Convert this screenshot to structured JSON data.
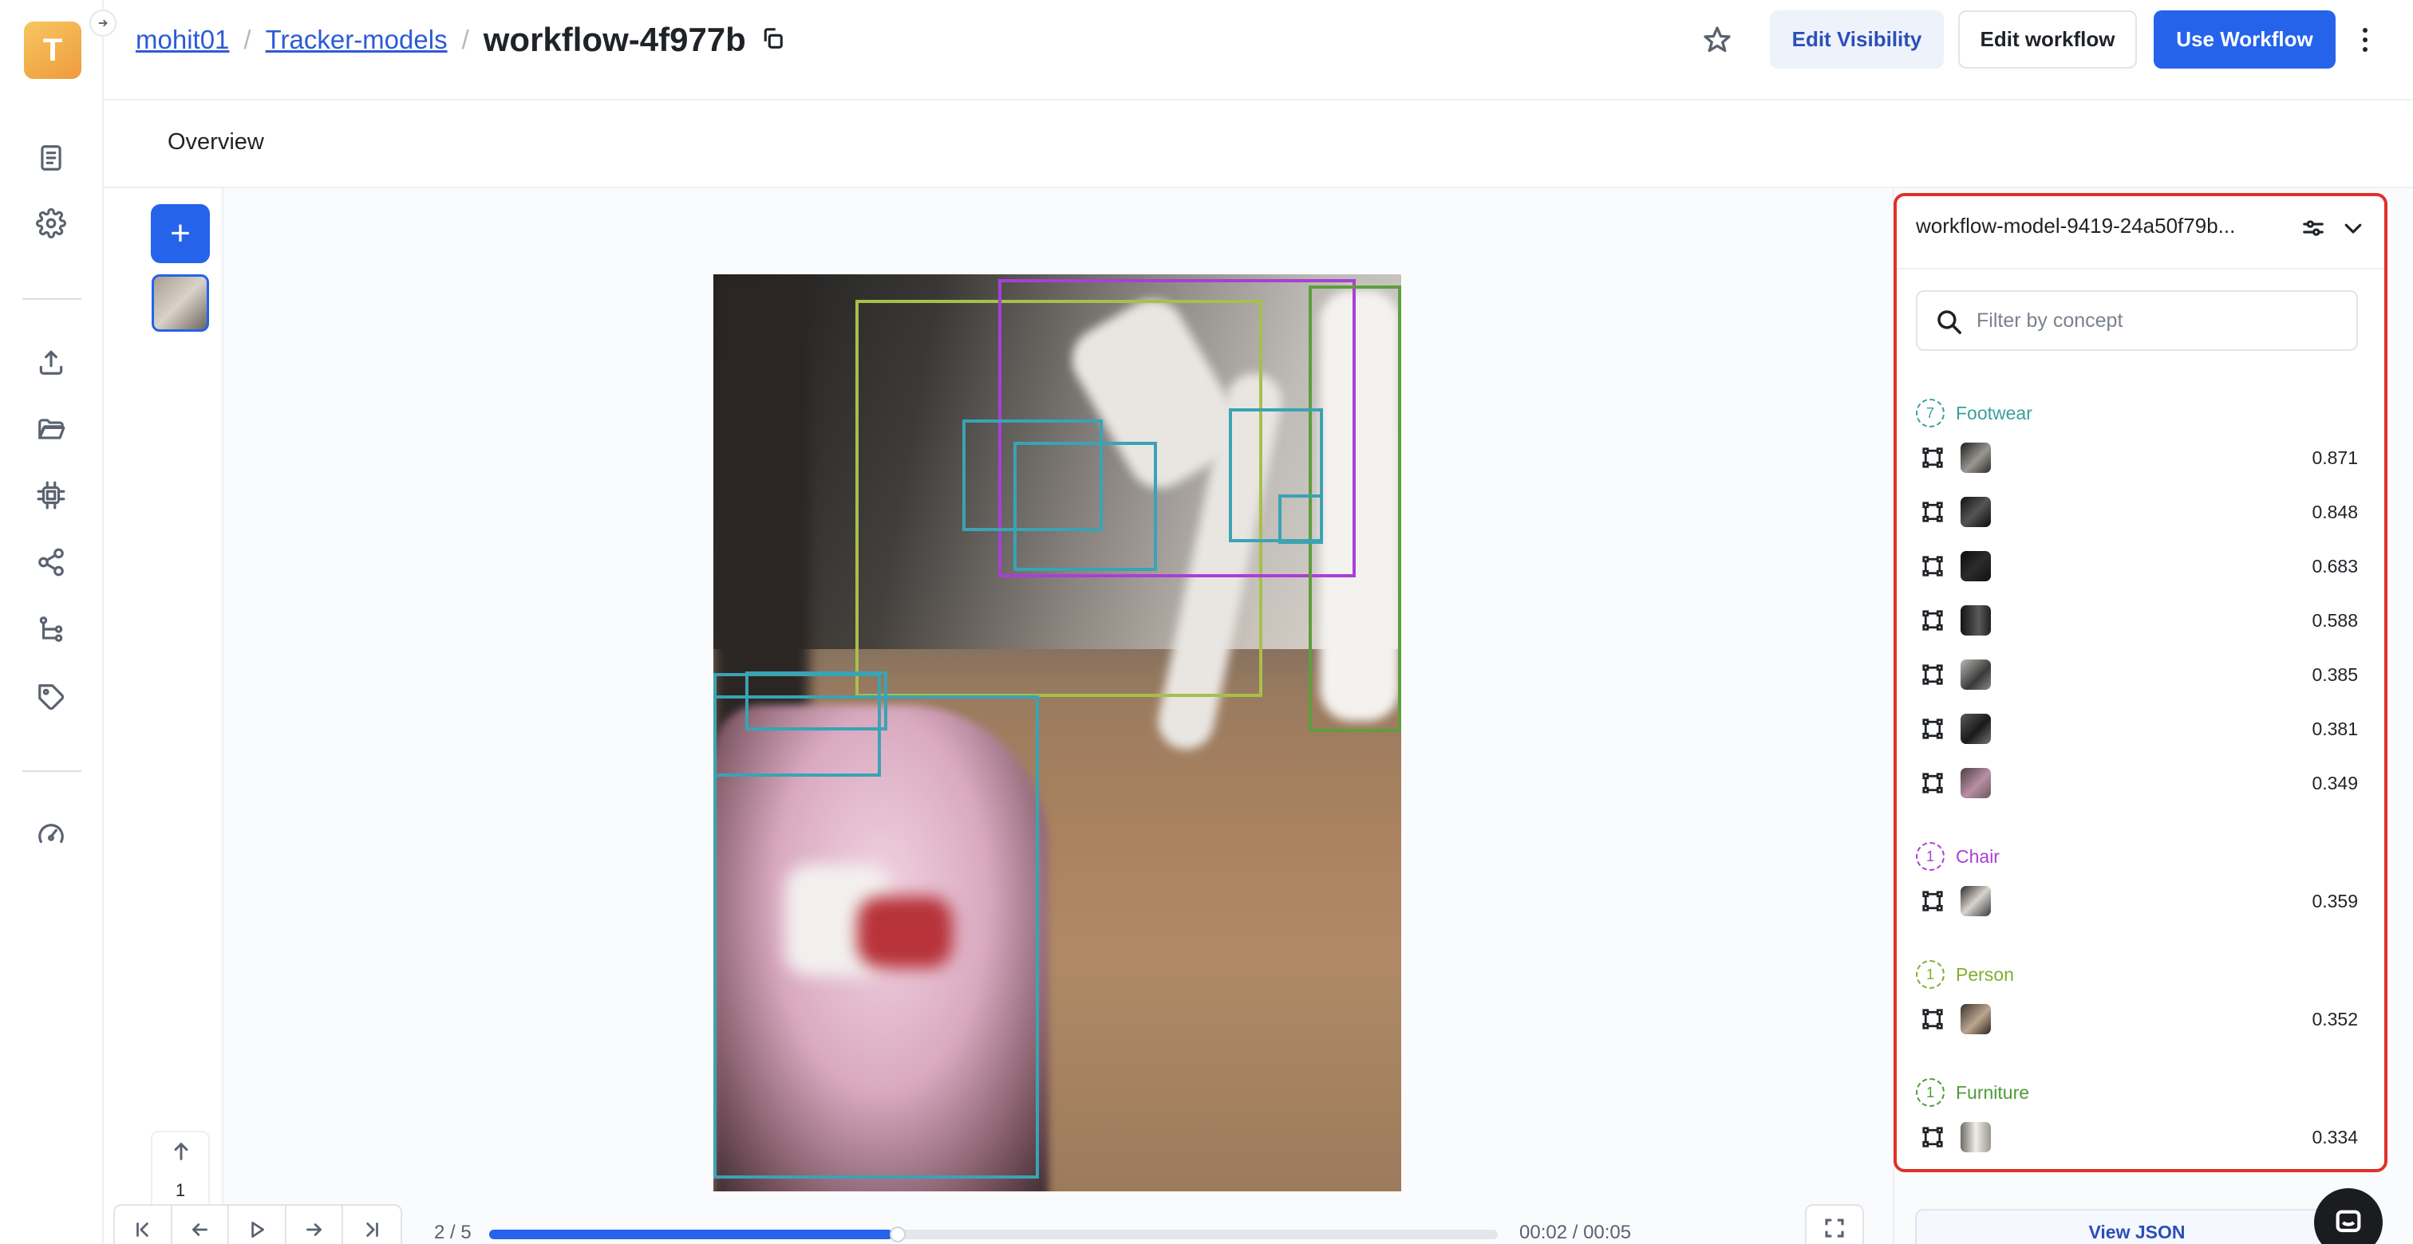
{
  "app": {
    "logo_letter": "T"
  },
  "breadcrumb": {
    "user": "mohit01",
    "app": "Tracker-models",
    "current": "workflow-4f977b",
    "separator": "/"
  },
  "header_actions": {
    "edit_visibility": "Edit Visibility",
    "edit_workflow": "Edit workflow",
    "use_workflow": "Use Workflow"
  },
  "tabs": {
    "overview": "Overview"
  },
  "frames": {
    "add_symbol": "+",
    "current_index": "1"
  },
  "timeline": {
    "frame_counter": "2 / 5",
    "time": "00:02 / 00:05",
    "progress": 0.4
  },
  "panel": {
    "title": "workflow-model-9419-24a50f79b...",
    "filter_placeholder": "Filter by concept",
    "view_json": "View JSON",
    "groups": [
      {
        "name": "Footwear",
        "count": "7",
        "color": "#3a9f9a",
        "items": [
          {
            "score": "0.871"
          },
          {
            "score": "0.848"
          },
          {
            "score": "0.683"
          },
          {
            "score": "0.588"
          },
          {
            "score": "0.385"
          },
          {
            "score": "0.381"
          },
          {
            "score": "0.349"
          }
        ]
      },
      {
        "name": "Chair",
        "count": "1",
        "color": "#a93fd6",
        "items": [
          {
            "score": "0.359"
          }
        ]
      },
      {
        "name": "Person",
        "count": "1",
        "color": "#7fae2e",
        "items": [
          {
            "score": "0.352"
          }
        ]
      },
      {
        "name": "Furniture",
        "count": "1",
        "color": "#4f9a3a",
        "items": [
          {
            "score": "0.334"
          }
        ]
      }
    ]
  },
  "colors": {
    "accent": "#2563eb",
    "highlight": "#e0302a",
    "footwear_box": "#3aa3b4",
    "chair_box": "#a93fd6",
    "person_box": "#a7c04a",
    "furniture_box": "#5f9d3e"
  }
}
